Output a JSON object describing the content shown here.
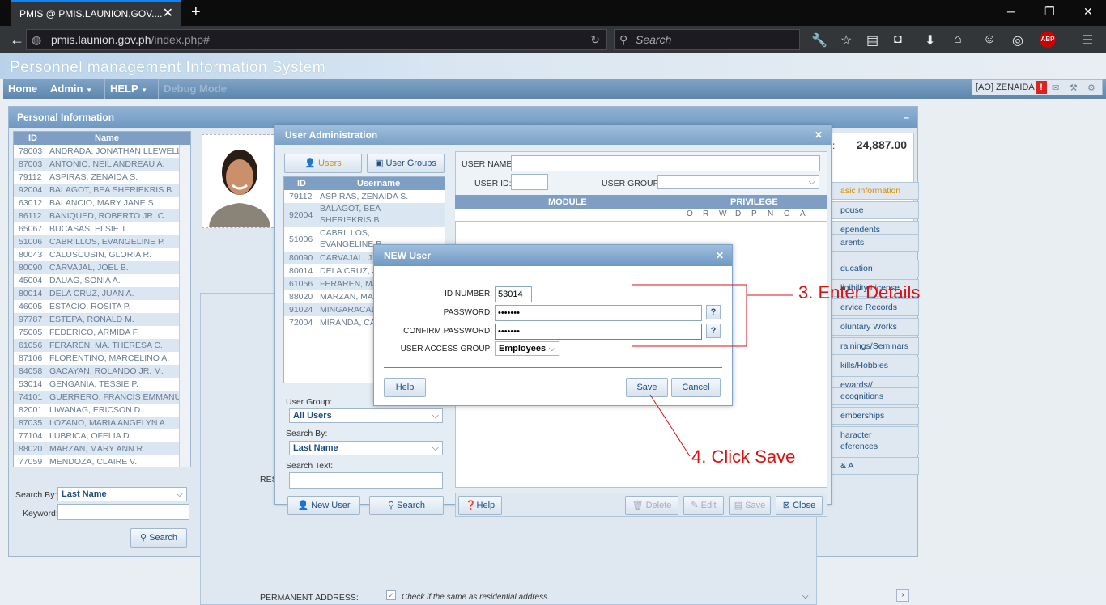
{
  "browser": {
    "tab_title": "PMIS @ PMIS.LAUNION.GOV....",
    "url_host": "pmis.launion.gov.ph",
    "url_path": "/index.php#",
    "search_placeholder": "Search"
  },
  "app": {
    "title": "Personnel management Information System",
    "menu": [
      "Home",
      "Admin",
      "HELP",
      "Debug Mode"
    ],
    "user_label": "[AO] ZENAIDA"
  },
  "personal": {
    "header": "Personal Information",
    "salary": "24,887.00",
    "columns": [
      "ID",
      "Name"
    ],
    "rows": [
      [
        "78003",
        "ANDRADA, JONATHAN LLEWELLYN"
      ],
      [
        "87003",
        "ANTONIO, NEIL ANDREAU A."
      ],
      [
        "79112",
        "ASPIRAS, ZENAIDA S."
      ],
      [
        "92004",
        "BALAGOT, BEA SHERIEKRIS B."
      ],
      [
        "63012",
        "BALANCIO, MARY JANE S."
      ],
      [
        "86112",
        "BANIQUED, ROBERTO JR. C."
      ],
      [
        "65067",
        "BUCASAS, ELSIE T."
      ],
      [
        "51006",
        "CABRILLOS, EVANGELINE P."
      ],
      [
        "80043",
        "CALUSCUSIN, GLORIA R."
      ],
      [
        "80090",
        "CARVAJAL, JOEL B."
      ],
      [
        "45004",
        "DAUAG, SONIA A."
      ],
      [
        "80014",
        "DELA CRUZ, JUAN A."
      ],
      [
        "46005",
        "ESTACIO, ROSITA P."
      ],
      [
        "97787",
        "ESTEPA, RONALD M."
      ],
      [
        "75005",
        "FEDERICO, ARMIDA F."
      ],
      [
        "61056",
        "FERAREN, MA. THERESA C."
      ],
      [
        "87106",
        "FLORENTINO, MARCELINO A."
      ],
      [
        "84058",
        "GACAYAN, ROLANDO JR. M."
      ],
      [
        "53014",
        "GENGANIA, TESSIE P."
      ],
      [
        "74101",
        "GUERRERO, FRANCIS EMMANUEL"
      ],
      [
        "82001",
        "LIWANAG, ERICSON D."
      ],
      [
        "87035",
        "LOZANO, MARIA ANGELYN A."
      ],
      [
        "77104",
        "LUBRICA, OFELIA D."
      ],
      [
        "88020",
        "MARZAN, MARY ANN R."
      ],
      [
        "77059",
        "MENDOZA, CLAIRE V."
      ]
    ],
    "search_by_label": "Search By:",
    "search_by_value": "Last Name",
    "keyword_label": "Keyword:",
    "search_button": "Search",
    "permanent_address_label": "PERMANENT ADDRESS:",
    "same_as_residential": "Check if the same as residential address.",
    "res_label": "RES",
    "side_tabs": [
      "asic Information",
      "pouse",
      "ependents",
      "arents",
      "ducation",
      "ligibility/License",
      "ervice Records",
      "oluntary Works",
      "rainings/Seminars",
      "kills/Hobbies",
      "ewards//",
      "ecognitions",
      "emberships",
      "haracter",
      "eferences",
      "& A"
    ]
  },
  "user_admin": {
    "title": "User Administration",
    "tabs": [
      "Users",
      "User Groups"
    ],
    "columns": [
      "ID",
      "Username"
    ],
    "rows": [
      [
        "79112",
        "ASPIRAS, ZENAIDA S."
      ],
      [
        "92004",
        "BALAGOT, BEA SHERIEKRIS B."
      ],
      [
        "51006",
        "CABRILLOS, EVANGELINE P."
      ],
      [
        "80090",
        "CARVAJAL, J"
      ],
      [
        "80014",
        "DELA CRUZ, J"
      ],
      [
        "61056",
        "FERAREN, MA"
      ],
      [
        "88020",
        "MARZAN, MA"
      ],
      [
        "91024",
        "MINGARACAL"
      ],
      [
        "72004",
        "MIRANDA, CA"
      ]
    ],
    "user_group_label": "User Group:",
    "user_group_value": "All Users",
    "search_by_label": "Search By:",
    "search_by_value": "Last Name",
    "search_text_label": "Search Text:",
    "new_user_button": "New User",
    "search_button": "Search",
    "user_name_label": "USER NAME:",
    "user_id_label": "USER ID:",
    "user_group_field_label": "USER GROUP:",
    "module_header": "MODULE",
    "privilege_header": "PRIVILEGE",
    "privileges": [
      "O",
      "R",
      "W",
      "D",
      "P",
      "N",
      "C",
      "A"
    ],
    "help_button": "Help",
    "delete_button": "Delete",
    "edit_button": "Edit",
    "save_button": "Save",
    "close_button": "Close"
  },
  "new_user": {
    "title": "NEW User",
    "id_label": "ID NUMBER:",
    "id_value": "53014",
    "password_label": "PASSWORD:",
    "password_value": "•••••••",
    "confirm_label": "CONFIRM PASSWORD:",
    "confirm_value": "•••••••",
    "access_label": "USER ACCESS GROUP:",
    "access_value": "Employees",
    "help_button": "Help",
    "save_button": "Save",
    "cancel_button": "Cancel"
  },
  "annotations": {
    "step3": "3. Enter Details",
    "step4": "4. Click Save"
  },
  "colors": {
    "annotation": "#d11111",
    "header": "#6f98c1"
  }
}
